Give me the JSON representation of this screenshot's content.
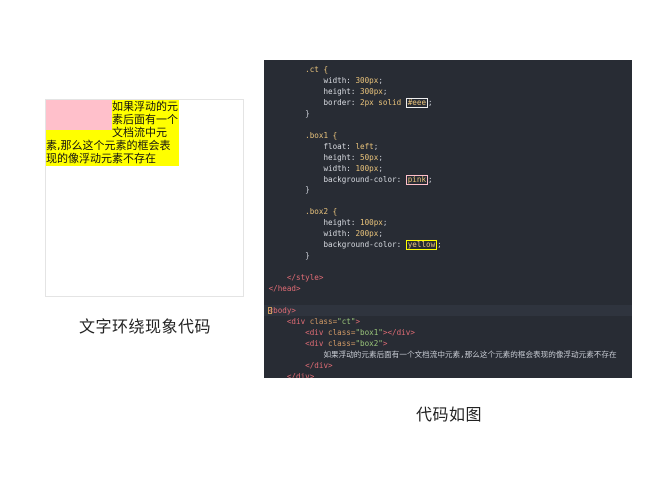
{
  "demo": {
    "text": "如果浮动的元素后面有一个文档流中元素,那么这个元素的框会表现的像浮动元素不存在",
    "caption": "文字环绕现象代码",
    "colors": {
      "frame_border": "#eeeeee",
      "float_box": "#ffc0cb",
      "text_box": "#ffff00"
    }
  },
  "editor": {
    "theme_colors": {
      "background": "#282c34",
      "selector": "#e5c07b",
      "tag": "#e06c75",
      "string": "#98c379"
    },
    "lines": [
      {
        "indent": "        ",
        "tokens": [
          {
            "t": "sel",
            "v": ".ct {"
          }
        ]
      },
      {
        "indent": "            ",
        "tokens": [
          {
            "t": "prop",
            "v": "width: "
          },
          {
            "t": "val",
            "v": "300px"
          },
          {
            "t": "punc",
            "v": ";"
          }
        ]
      },
      {
        "indent": "            ",
        "tokens": [
          {
            "t": "prop",
            "v": "height: "
          },
          {
            "t": "val",
            "v": "300px"
          },
          {
            "t": "punc",
            "v": ";"
          }
        ]
      },
      {
        "indent": "            ",
        "tokens": [
          {
            "t": "prop",
            "v": "border: "
          },
          {
            "t": "val",
            "v": "2px solid "
          },
          {
            "t": "swatch-eee",
            "v": "#eee"
          },
          {
            "t": "punc",
            "v": ";"
          }
        ]
      },
      {
        "indent": "        ",
        "tokens": [
          {
            "t": "punc",
            "v": "}"
          }
        ]
      },
      {
        "indent": "",
        "tokens": []
      },
      {
        "indent": "        ",
        "tokens": [
          {
            "t": "sel",
            "v": ".box1 {"
          }
        ]
      },
      {
        "indent": "            ",
        "tokens": [
          {
            "t": "prop",
            "v": "float: "
          },
          {
            "t": "val",
            "v": "left"
          },
          {
            "t": "punc",
            "v": ";"
          }
        ]
      },
      {
        "indent": "            ",
        "tokens": [
          {
            "t": "prop",
            "v": "height: "
          },
          {
            "t": "val",
            "v": "50px"
          },
          {
            "t": "punc",
            "v": ";"
          }
        ]
      },
      {
        "indent": "            ",
        "tokens": [
          {
            "t": "prop",
            "v": "width: "
          },
          {
            "t": "val",
            "v": "100px"
          },
          {
            "t": "punc",
            "v": ";"
          }
        ]
      },
      {
        "indent": "            ",
        "tokens": [
          {
            "t": "prop",
            "v": "background-color: "
          },
          {
            "t": "swatch-pink",
            "v": "pink"
          },
          {
            "t": "punc",
            "v": ";"
          }
        ]
      },
      {
        "indent": "        ",
        "tokens": [
          {
            "t": "punc",
            "v": "}"
          }
        ]
      },
      {
        "indent": "",
        "tokens": []
      },
      {
        "indent": "        ",
        "tokens": [
          {
            "t": "sel",
            "v": ".box2 {"
          }
        ]
      },
      {
        "indent": "            ",
        "tokens": [
          {
            "t": "prop",
            "v": "height: "
          },
          {
            "t": "val",
            "v": "100px"
          },
          {
            "t": "punc",
            "v": ";"
          }
        ]
      },
      {
        "indent": "            ",
        "tokens": [
          {
            "t": "prop",
            "v": "width: "
          },
          {
            "t": "val",
            "v": "200px"
          },
          {
            "t": "punc",
            "v": ";"
          }
        ]
      },
      {
        "indent": "            ",
        "tokens": [
          {
            "t": "prop",
            "v": "background-color: "
          },
          {
            "t": "swatch-yellow",
            "v": "yellow"
          },
          {
            "t": "punc",
            "v": ";"
          }
        ]
      },
      {
        "indent": "        ",
        "tokens": [
          {
            "t": "punc",
            "v": "}"
          }
        ]
      },
      {
        "indent": "",
        "tokens": []
      },
      {
        "indent": "    ",
        "tokens": [
          {
            "t": "tag",
            "v": "</style>"
          }
        ]
      },
      {
        "indent": "",
        "tokens": [
          {
            "t": "tag",
            "v": "</head>"
          }
        ]
      },
      {
        "indent": "",
        "tokens": []
      },
      {
        "indent": "",
        "highlight": true,
        "tokens": [
          {
            "t": "tag",
            "v": "<body>"
          }
        ]
      },
      {
        "indent": "    ",
        "tokens": [
          {
            "t": "tag",
            "v": "<div "
          },
          {
            "t": "attr",
            "v": "class="
          },
          {
            "t": "str",
            "v": "\"ct\""
          },
          {
            "t": "tag",
            "v": ">"
          }
        ]
      },
      {
        "indent": "        ",
        "tokens": [
          {
            "t": "tag",
            "v": "<div "
          },
          {
            "t": "attr",
            "v": "class="
          },
          {
            "t": "str",
            "v": "\"box1\""
          },
          {
            "t": "tag",
            "v": "></div>"
          }
        ]
      },
      {
        "indent": "        ",
        "tokens": [
          {
            "t": "tag",
            "v": "<div "
          },
          {
            "t": "attr",
            "v": "class="
          },
          {
            "t": "str",
            "v": "\"box2\""
          },
          {
            "t": "tag",
            "v": ">"
          }
        ]
      },
      {
        "indent": "            ",
        "tokens": [
          {
            "t": "text",
            "v": "如果浮动的元素后面有一个文档流中元素,那么这个元素的框会表现的像浮动元素不存在"
          }
        ]
      },
      {
        "indent": "        ",
        "tokens": [
          {
            "t": "tag",
            "v": "</div>"
          }
        ]
      },
      {
        "indent": "    ",
        "tokens": [
          {
            "t": "tag",
            "v": "</div>"
          }
        ]
      }
    ],
    "caption": "代码如图"
  }
}
